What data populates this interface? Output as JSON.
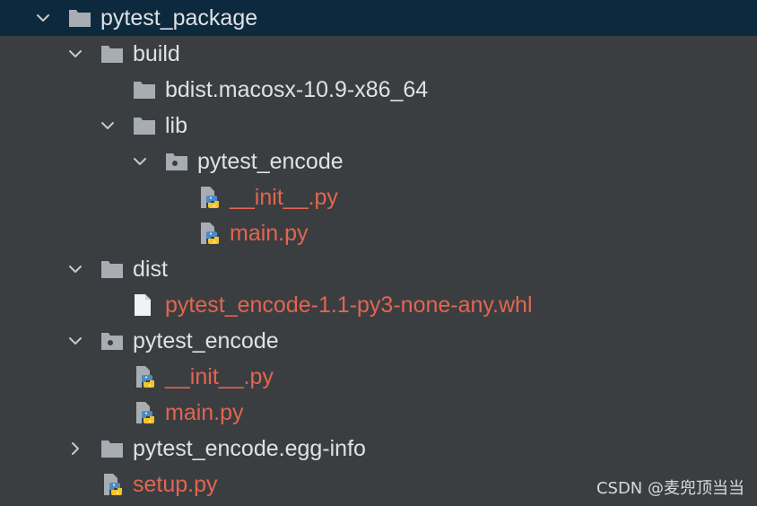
{
  "tree": {
    "root": {
      "label": "pytest_package",
      "icon": "folder-icon",
      "expanded": true
    },
    "build": {
      "label": "build",
      "icon": "folder-icon",
      "expanded": true
    },
    "bdist": {
      "label": "bdist.macosx-10.9-x86_64",
      "icon": "folder-icon"
    },
    "lib": {
      "label": "lib",
      "icon": "folder-icon",
      "expanded": true
    },
    "lib_pkg": {
      "label": "pytest_encode",
      "icon": "package-folder-icon",
      "expanded": true
    },
    "lib_init": {
      "label": "__init__.py",
      "icon": "python-file-icon"
    },
    "lib_main": {
      "label": "main.py",
      "icon": "python-file-icon"
    },
    "dist": {
      "label": "dist",
      "icon": "folder-icon",
      "expanded": true
    },
    "whl": {
      "label": "pytest_encode-1.1-py3-none-any.whl",
      "icon": "file-icon"
    },
    "pkg": {
      "label": "pytest_encode",
      "icon": "package-folder-icon",
      "expanded": true
    },
    "pkg_init": {
      "label": "__init__.py",
      "icon": "python-file-icon"
    },
    "pkg_main": {
      "label": "main.py",
      "icon": "python-file-icon"
    },
    "egg": {
      "label": "pytest_encode.egg-info",
      "icon": "folder-icon",
      "expanded": false
    },
    "setup": {
      "label": "setup.py",
      "icon": "python-file-icon"
    }
  },
  "colors": {
    "background": "#3b3e41",
    "selected_row": "#0d293e",
    "folder_text": "#dfe1e5",
    "untracked_file_text": "#e3654f",
    "folder_icon": "#a7adb3"
  },
  "watermark": "CSDN @麦兜顶当当"
}
